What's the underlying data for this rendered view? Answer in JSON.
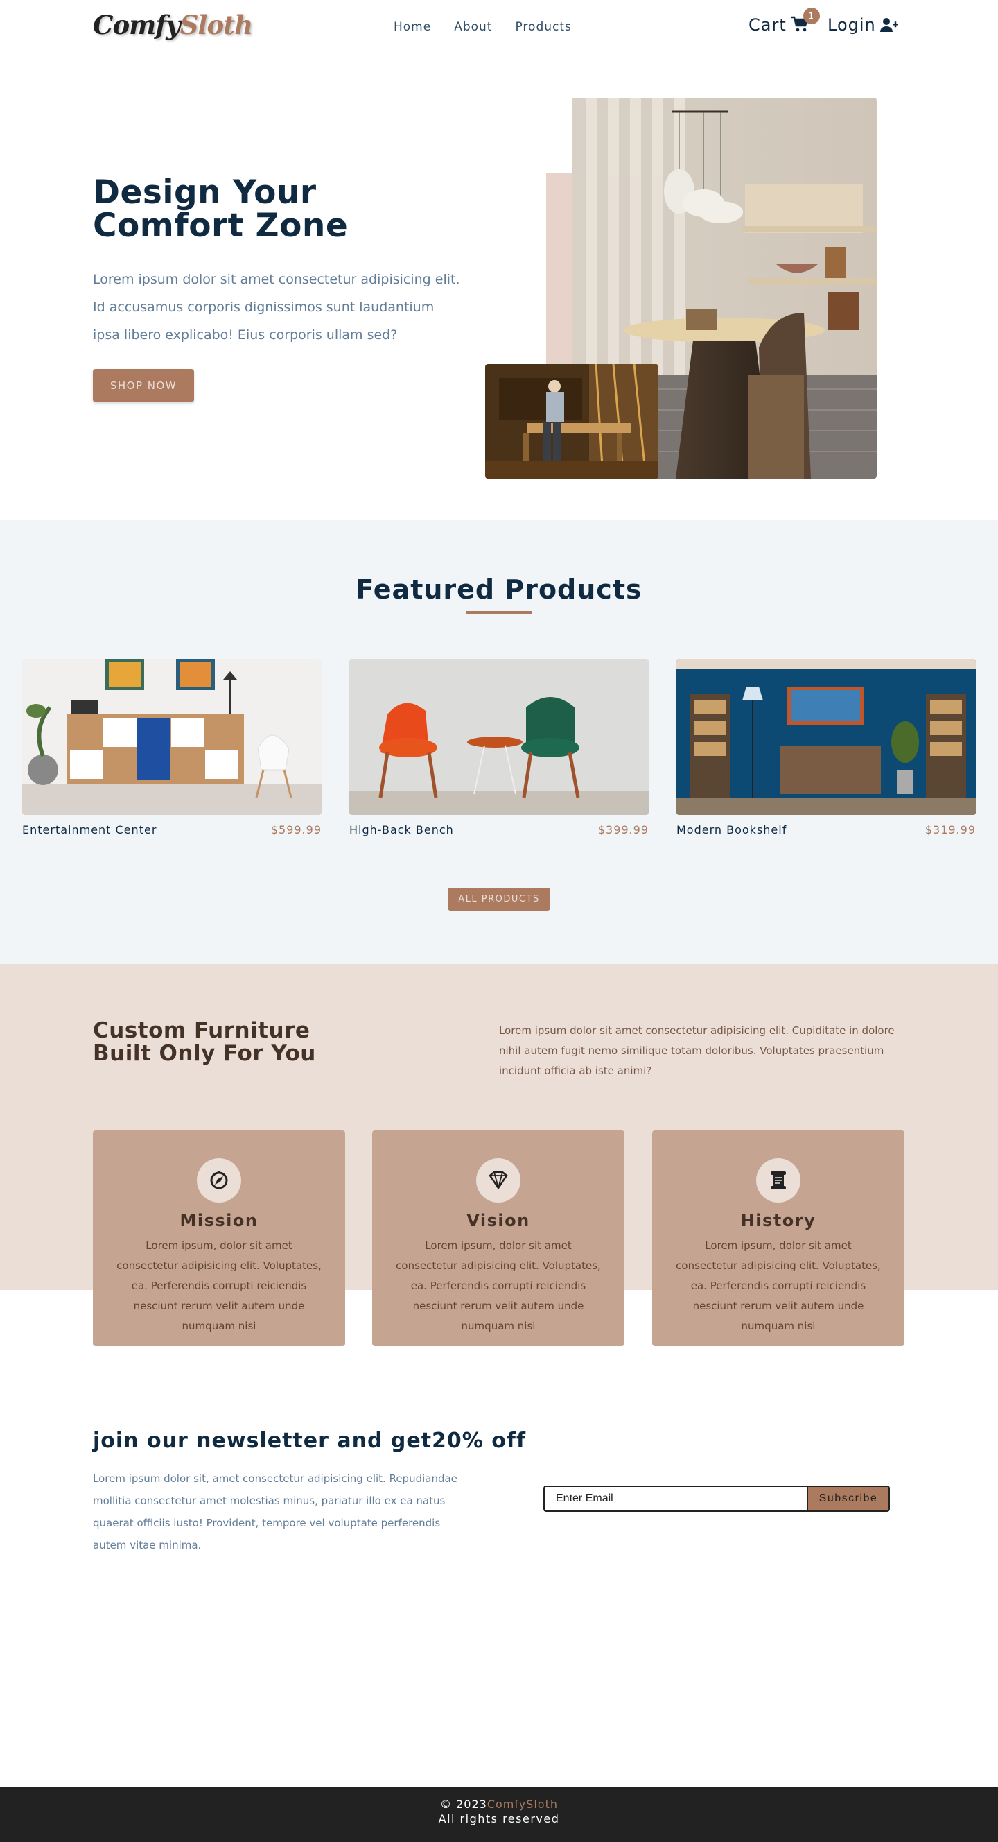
{
  "brand": {
    "part1": "Comfy",
    "part2": "Sloth"
  },
  "nav": {
    "links": [
      "Home",
      "About",
      "Products"
    ],
    "cart_label": "Cart",
    "cart_count": "1",
    "login_label": "Login"
  },
  "hero": {
    "title_line1": "Design Your",
    "title_line2": "Comfort Zone",
    "text": "Lorem ipsum dolor sit amet consectetur adipisicing elit. Id accusamus corporis dignissimos sunt laudantium ipsa libero explicabo! Eius corporis ullam sed?",
    "button": "SHOP NOW"
  },
  "featured": {
    "title": "Featured Products",
    "products": [
      {
        "name": "Entertainment Center",
        "price": "$599.99"
      },
      {
        "name": "High-Back Bench",
        "price": "$399.99"
      },
      {
        "name": "Modern Bookshelf",
        "price": "$319.99"
      }
    ],
    "button": "ALL PRODUCTS"
  },
  "about": {
    "title_line1": "Custom Furniture",
    "title_line2": "Built Only For You",
    "text": "Lorem ipsum dolor sit amet consectetur adipisicing elit. Cupiditate in dolore nihil autem fugit nemo similique totam doloribus. Voluptates praesentium incidunt officia ab iste animi?",
    "cards": [
      {
        "title": "Mission",
        "icon": "compass-icon",
        "text": "Lorem ipsum, dolor sit amet consectetur adipisicing elit. Voluptates, ea. Perferendis corrupti reiciendis nesciunt rerum velit autem unde numquam nisi"
      },
      {
        "title": "Vision",
        "icon": "diamond-icon",
        "text": "Lorem ipsum, dolor sit amet consectetur adipisicing elit. Voluptates, ea. Perferendis corrupti reiciendis nesciunt rerum velit autem unde numquam nisi"
      },
      {
        "title": "History",
        "icon": "scroll-icon",
        "text": "Lorem ipsum, dolor sit amet consectetur adipisicing elit. Voluptates, ea. Perferendis corrupti reiciendis nesciunt rerum velit autem unde numquam nisi"
      }
    ]
  },
  "newsletter": {
    "title": "join our newsletter and get20% off",
    "text": "Lorem ipsum dolor sit, amet consectetur adipisicing elit. Repudiandae mollitia consectetur amet molestias minus, pariatur illo ex ea natus quaerat officiis iusto! Provident, tempore vel voluptate perferendis autem vitae minima.",
    "placeholder": "Enter Email",
    "button": "Subscribe"
  },
  "footer": {
    "copyright": "© 2023",
    "brand": "ComfySloth",
    "rights": "All rights reserved"
  },
  "colors": {
    "primary": "#ab7a5f",
    "dark": "#102a42",
    "featured_bg": "#f1f5f8",
    "about_bg": "#eaded7",
    "card_bg": "#c5a491",
    "footer_bg": "#222222"
  }
}
